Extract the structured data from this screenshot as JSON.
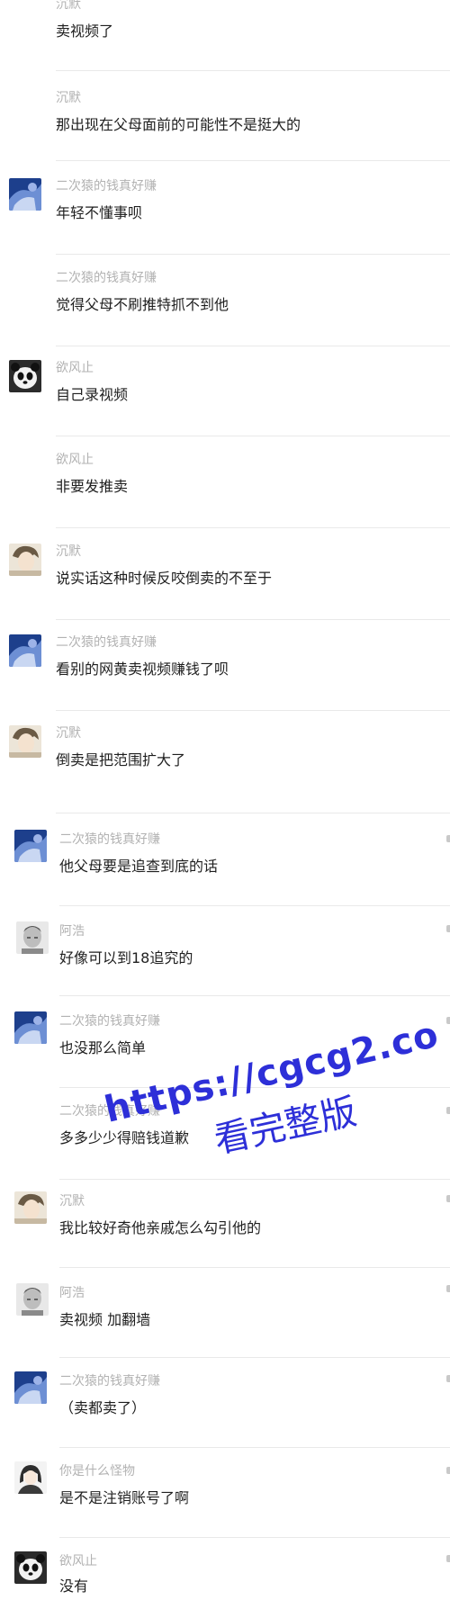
{
  "messages": [
    {
      "name": "沉默",
      "text": "卖视频了",
      "avatar": null
    },
    {
      "name": "沉默",
      "text": "那出现在父母面前的可能性不是挺大的",
      "avatar": null
    },
    {
      "name": "二次猿的钱真好赚",
      "text": "年轻不懂事呗",
      "avatar": "blue-art-avatar"
    },
    {
      "name": "二次猿的钱真好赚",
      "text": "觉得父母不刷推特抓不到他",
      "avatar": null
    },
    {
      "name": "欲风止",
      "text": "自己录视频",
      "avatar": "panda-avatar"
    },
    {
      "name": "欲风止",
      "text": "非要发推卖",
      "avatar": null
    },
    {
      "name": "沉默",
      "text": "说实话这种时候反咬倒卖的不至于",
      "avatar": "anime-boy-avatar"
    },
    {
      "name": "二次猿的钱真好赚",
      "text": "看别的网黄卖视频赚钱了呗",
      "avatar": "blue-art-avatar"
    },
    {
      "name": "沉默",
      "text": "倒卖是把范围扩大了",
      "avatar": "anime-boy-avatar"
    },
    {
      "name": "二次猿的钱真好赚",
      "text": "他父母要是追查到底的话",
      "avatar": "blue-art-avatar"
    },
    {
      "name": "阿浩",
      "text": "好像可以到18追究的",
      "avatar": "sketch-face-avatar"
    },
    {
      "name": "二次猿的钱真好赚",
      "text": "也没那么简单",
      "avatar": "blue-art-avatar"
    },
    {
      "name": "二次猿的钱真好赚",
      "text": "多多少少得赔钱道歉",
      "avatar": null
    },
    {
      "name": "沉默",
      "text": "我比较好奇他亲戚怎么勾引他的",
      "avatar": "anime-boy-avatar"
    },
    {
      "name": "阿浩",
      "text": "卖视频 加翻墙",
      "avatar": "sketch-face-avatar"
    },
    {
      "name": "二次猿的钱真好赚",
      "text": "（卖都卖了）",
      "avatar": "blue-art-avatar"
    },
    {
      "name": "你是什么怪物",
      "text": "是不是注销账号了啊",
      "avatar": "anime-girl-avatar"
    },
    {
      "name": "欲风止",
      "text": "没有",
      "avatar": "panda-avatar"
    }
  ],
  "watermark": {
    "url": "https://cgcg2.co",
    "caption": "看完整版"
  }
}
